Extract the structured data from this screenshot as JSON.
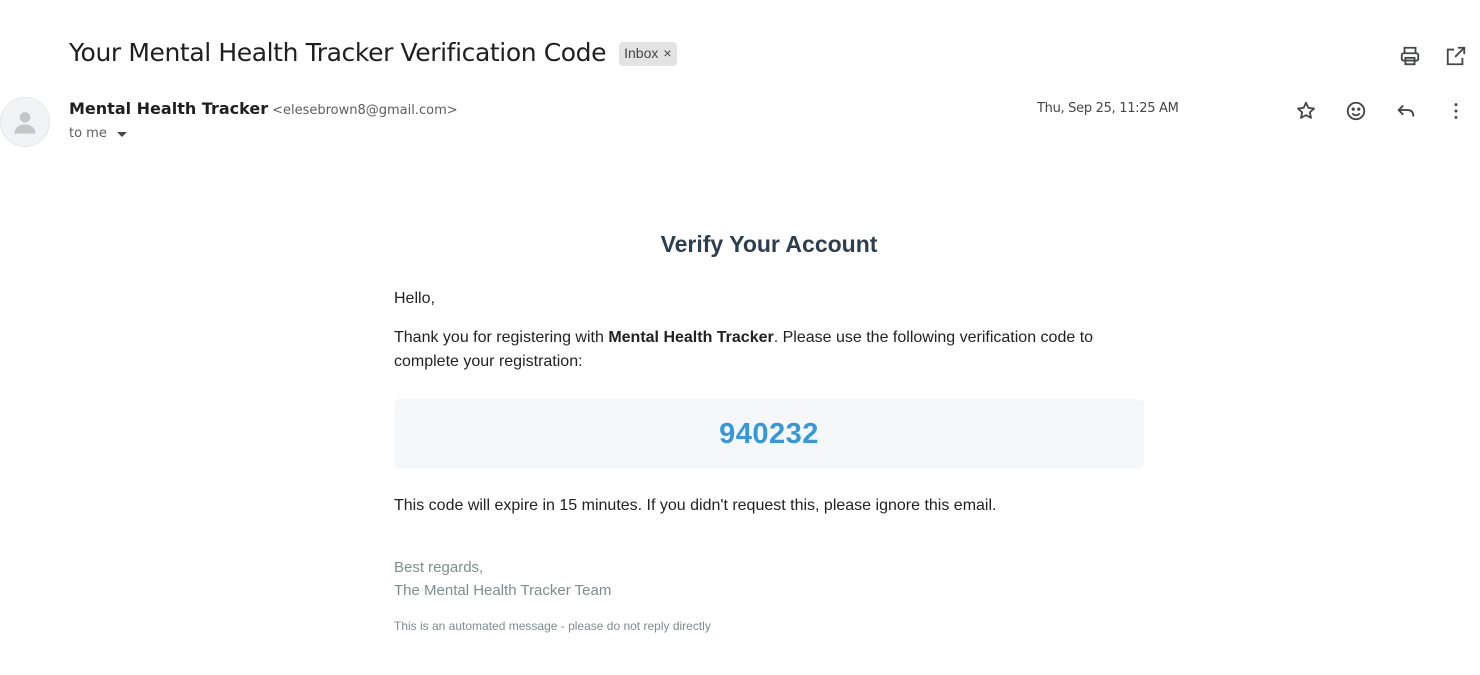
{
  "email": {
    "subject": "Your Mental Health Tracker Verification Code",
    "label": "Inbox",
    "label_remove": "×",
    "sender_name": "Mental Health Tracker",
    "sender_email": "<elesebrown8@gmail.com>",
    "recipient": "to me",
    "date": "Thu, Sep 25, 11:25 AM"
  },
  "icons": {
    "print": "print-icon",
    "open_new_window": "open-in-new-window-icon",
    "star": "star-icon",
    "emoji": "emoji-react-icon",
    "reply": "reply-icon",
    "more": "more-vert-icon",
    "avatar": "person-avatar-icon"
  },
  "body": {
    "heading": "Verify Your Account",
    "greeting": "Hello,",
    "intro_before": "Thank you for registering with ",
    "intro_bold": "Mental Health Tracker",
    "intro_after": ". Please use the following verification code to complete your registration:",
    "code": "940232",
    "expire_note": "This code will expire in 15 minutes. If you didn't request this, please ignore this email.",
    "signoff_1": "Best regards,",
    "signoff_2": "The Mental Health Tracker Team",
    "footnote": "This is an automated message - please do not reply directly"
  },
  "colors": {
    "heading": "#2c3e50",
    "code": "#3498db",
    "code_bg": "#f6f7f8",
    "muted": "#7f8c8d"
  }
}
